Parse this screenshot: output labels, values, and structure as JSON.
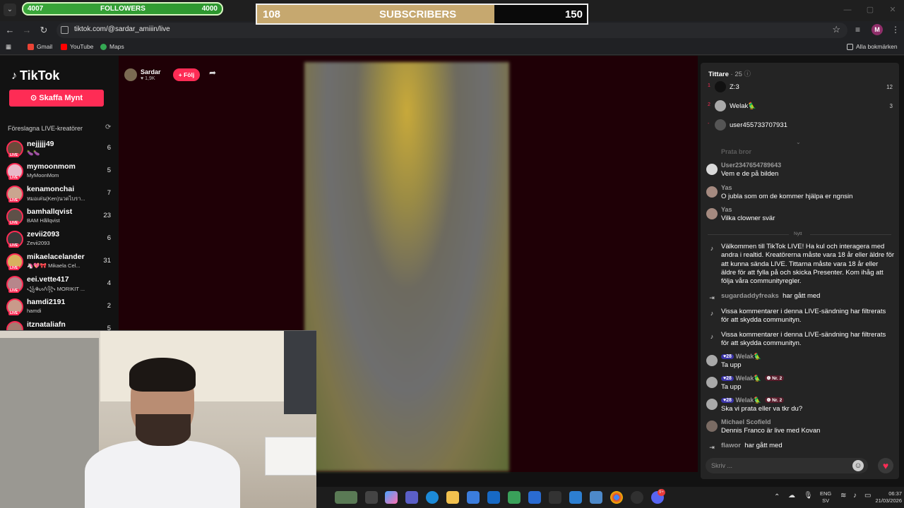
{
  "browser": {
    "url": "tiktok.com/@sardar_amiiin/live",
    "bookmarks": [
      "Gmail",
      "YouTube",
      "Maps"
    ],
    "all_bookmarks": "Alla bokmärken",
    "profile_initial": "M"
  },
  "overlay": {
    "followers": {
      "current": "4007",
      "label": "FOLLOWERS",
      "goal": "4000"
    },
    "subscribers": {
      "current": "108",
      "label": "SUBSCRIBERS",
      "goal": "150",
      "progress": 0.72
    }
  },
  "sidebar": {
    "logo": "TikTok",
    "coins_button": "Skaffa Mynt",
    "suggested_title": "Föreslagna LIVE-kreatörer",
    "creators": [
      {
        "name": "nejjjjj49",
        "sub": "🍆🍆",
        "count": "6",
        "color": "#6b4a3a"
      },
      {
        "name": "mymoonmom",
        "sub": "MyMoonMom",
        "count": "5",
        "color": "#e8b9c9"
      },
      {
        "name": "kenamonchai",
        "sub": "หมอเค่น(Ken)นวดไบรา...",
        "count": "7",
        "color": "#caa58f"
      },
      {
        "name": "bamhallqvist",
        "sub": "BAM Hållqvist",
        "count": "23",
        "color": "#5e5048"
      },
      {
        "name": "zevii2093",
        "sub": "Zevii2093",
        "count": "6",
        "color": "#3a3a3a"
      },
      {
        "name": "mikaelacelander",
        "sub": "🦄💖🎀 Mikaela Cel...",
        "count": "31",
        "color": "#d8b25f"
      },
      {
        "name": "eei.vette417",
        "sub": "꧁☬ᔕᐱ꧂ MORIKIT ...",
        "count": "4",
        "color": "#b7868b"
      },
      {
        "name": "hamdi2191",
        "sub": "hamdi",
        "count": "2",
        "color": "#c99a8a"
      },
      {
        "name": "itznataliafn",
        "sub": "",
        "count": "5",
        "color": "#a57a6f"
      }
    ]
  },
  "stream": {
    "host_name": "Sardar",
    "host_likes": "1,9K",
    "follow_label": "+ Följ"
  },
  "chat": {
    "viewers_title": "Tittare",
    "viewers_count": "· 25",
    "viewers": [
      {
        "rank": "1",
        "name": "Z:3",
        "score": "12",
        "color": "#111111"
      },
      {
        "rank": "2",
        "name": "Welak🦜",
        "score": "3",
        "color": "#a9a9a9"
      },
      {
        "rank": "-",
        "name": "user455733707931",
        "score": "",
        "color": "#cfcfcf"
      }
    ],
    "faded_msg": "Prata bror",
    "messages": [
      {
        "user": "User2347654789643",
        "text": "Vem e de på bilden",
        "color": "#d9d9d9"
      },
      {
        "user": "Yas",
        "text": "O jubla som om de kommer hjälpa er ngnsin",
        "color": "#a58a80"
      },
      {
        "user": "Yas",
        "text": "Vilka clowner svär",
        "color": "#a58a80"
      }
    ],
    "new_divider": "Nytt",
    "welcome": "Välkommen till TikTok LIVE! Ha kul och interagera med andra i realtid. Kreatörerna måste vara 18 år eller äldre för att kunna sända LIVE. Tittarna måste vara 18 år eller äldre för att fylla på och skicka Presenter. Kom ihåg att följa våra communityregler.",
    "join1": {
      "user": "sugardaddyfreaks",
      "text": "har gått med"
    },
    "filter1": "Vissa kommentarer i denna LIVE-sändning har filtrerats för att skydda communityn.",
    "filter2": "Vissa kommentarer i denna LIVE-sändning har filtrerats för att skydda communityn.",
    "welak_msgs": [
      {
        "level": "28",
        "user": "Welak🦜",
        "badge": "",
        "text": "Ta upp"
      },
      {
        "level": "28",
        "user": "Welak🦜",
        "badge": "Nr. 2",
        "text": "Ta upp"
      },
      {
        "level": "28",
        "user": "Welak🦜",
        "badge": "Nr. 2",
        "text": "Ska vi prata eller va tkr du?"
      }
    ],
    "michael": {
      "user": "Michael Scofield",
      "text": "Dennis Franco är live med Kovan"
    },
    "join2": {
      "user": "flawor",
      "text": "har gått med"
    },
    "input_placeholder": "Skriv ..."
  },
  "taskbar": {
    "lang": "ENG",
    "region": "SV",
    "time": "06:37",
    "date": "21/03/2026",
    "notif_badge": "9+"
  }
}
